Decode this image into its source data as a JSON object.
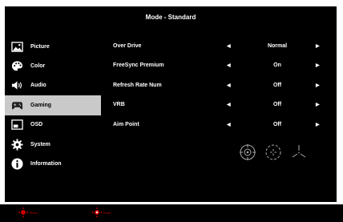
{
  "title": "Mode - Standard",
  "sidebar": {
    "items": [
      {
        "label": "Picture",
        "icon": "picture-icon"
      },
      {
        "label": "Color",
        "icon": "palette-icon"
      },
      {
        "label": "Audio",
        "icon": "speaker-icon"
      },
      {
        "label": "Gaming",
        "icon": "gamepad-icon",
        "selected": true
      },
      {
        "label": "OSD",
        "icon": "osd-icon"
      },
      {
        "label": "System",
        "icon": "gear-icon"
      },
      {
        "label": "Information",
        "icon": "info-icon"
      }
    ]
  },
  "settings": [
    {
      "label": "Over Drive",
      "value": "Normal"
    },
    {
      "label": "FreeSync Premium",
      "value": "On"
    },
    {
      "label": "Refresh Rate Num",
      "value": "Off"
    },
    {
      "label": "VRB",
      "value": "Off"
    },
    {
      "label": "Aim Point",
      "value": "Off"
    }
  ],
  "footer": {
    "move_label": "Move",
    "enter_label": "Enter",
    "accent_color": "#c80000"
  },
  "colors": {
    "background": "#000000",
    "selected_bg": "#c9c9c9",
    "text": "#ffffff"
  }
}
